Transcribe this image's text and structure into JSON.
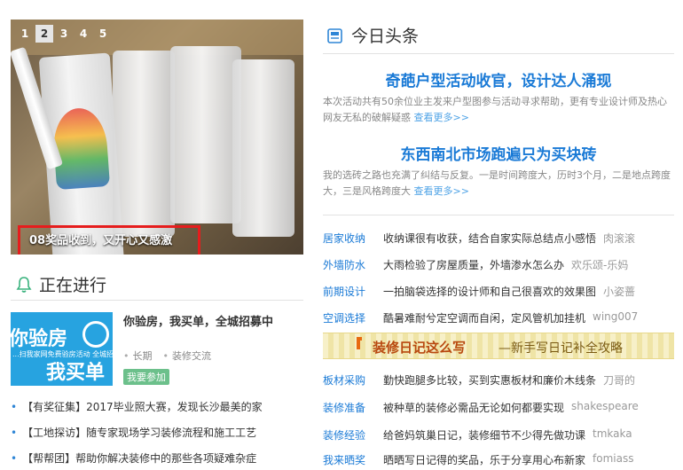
{
  "slider": {
    "pages": [
      "1",
      "2",
      "3",
      "4",
      "5"
    ],
    "active_page": "2",
    "caption": "08奖品收到，又开心又感激"
  },
  "ongoing": {
    "heading": "正在进行",
    "thumb_big_1": "你验房",
    "thumb_big_2": "我买单",
    "thumb_small": "...扫我家网免费验房活动 全城招募中！",
    "title": "你验房，我买单，全城招募中",
    "meta": [
      "长期",
      "装修交流"
    ],
    "join_label": "我要参加",
    "list": [
      "【有奖征集】2017毕业照大赛，发现长沙最美的家",
      "【工地探访】随专家现场学习装修流程和施工工艺",
      "【帮帮团】帮助你解决装修中的那些各项疑难杂症"
    ]
  },
  "headlines": {
    "heading": "今日头条",
    "items": [
      {
        "title": "奇葩户型活动收官，设计达人涌现",
        "summary": "本次活动共有50余位业主发来户型图参与活动寻求帮助，更有专业设计师及热心网友无私的破解疑惑",
        "more": "查看更多>>"
      },
      {
        "title": "东西南北市场跑遍只为买块砖",
        "summary": "我的选砖之路也充满了纠结与反复。一是时间跨度大，历时3个月，二是地点跨度大，三是风格跨度大",
        "more": "查看更多>>"
      }
    ]
  },
  "categories_top": [
    {
      "cat": "居家收纳",
      "text": "收纳课很有收获，结合自家实际总结点小感悟",
      "user": "肉滚滚"
    },
    {
      "cat": "外墙防水",
      "text": "大雨检验了房屋质量，外墙渗水怎么办",
      "user": "欢乐颂-乐妈"
    },
    {
      "cat": "前期设计",
      "text": "一拍脑袋选择的设计师和自己很喜欢的效果图",
      "user": "小姿蔷"
    },
    {
      "cat": "空调选择",
      "text": "酷暑难耐兮定空调而自闲，定风管机加挂机",
      "user": "wing007"
    }
  ],
  "banner": {
    "main": "装修日记这么写",
    "sub": "—新手写日记补全攻略"
  },
  "categories_bottom": [
    {
      "cat": "板材采购",
      "text": "勤快跑腿多比较，买到实惠板材和廉价木线条",
      "user": "刀哥的"
    },
    {
      "cat": "装修准备",
      "text": "被种草的装修必需品无论如何都要实现",
      "user": "shakespeare"
    },
    {
      "cat": "装修经验",
      "text": "给爸妈筑巢日记，装修细节不少得先做功课",
      "user": "tmkaka"
    },
    {
      "cat": "我来晒奖",
      "text": "晒晒写日记得的奖品，乐于分享用心布新家",
      "user": "fomiass"
    }
  ],
  "colors": {
    "accent_blue": "#1a7ad6",
    "caption_border": "#e61d1d",
    "join_green": "#6cc08b",
    "banner_orange": "#e86a10"
  },
  "icons": {
    "headlines": "news-icon",
    "ongoing": "bell-icon"
  }
}
